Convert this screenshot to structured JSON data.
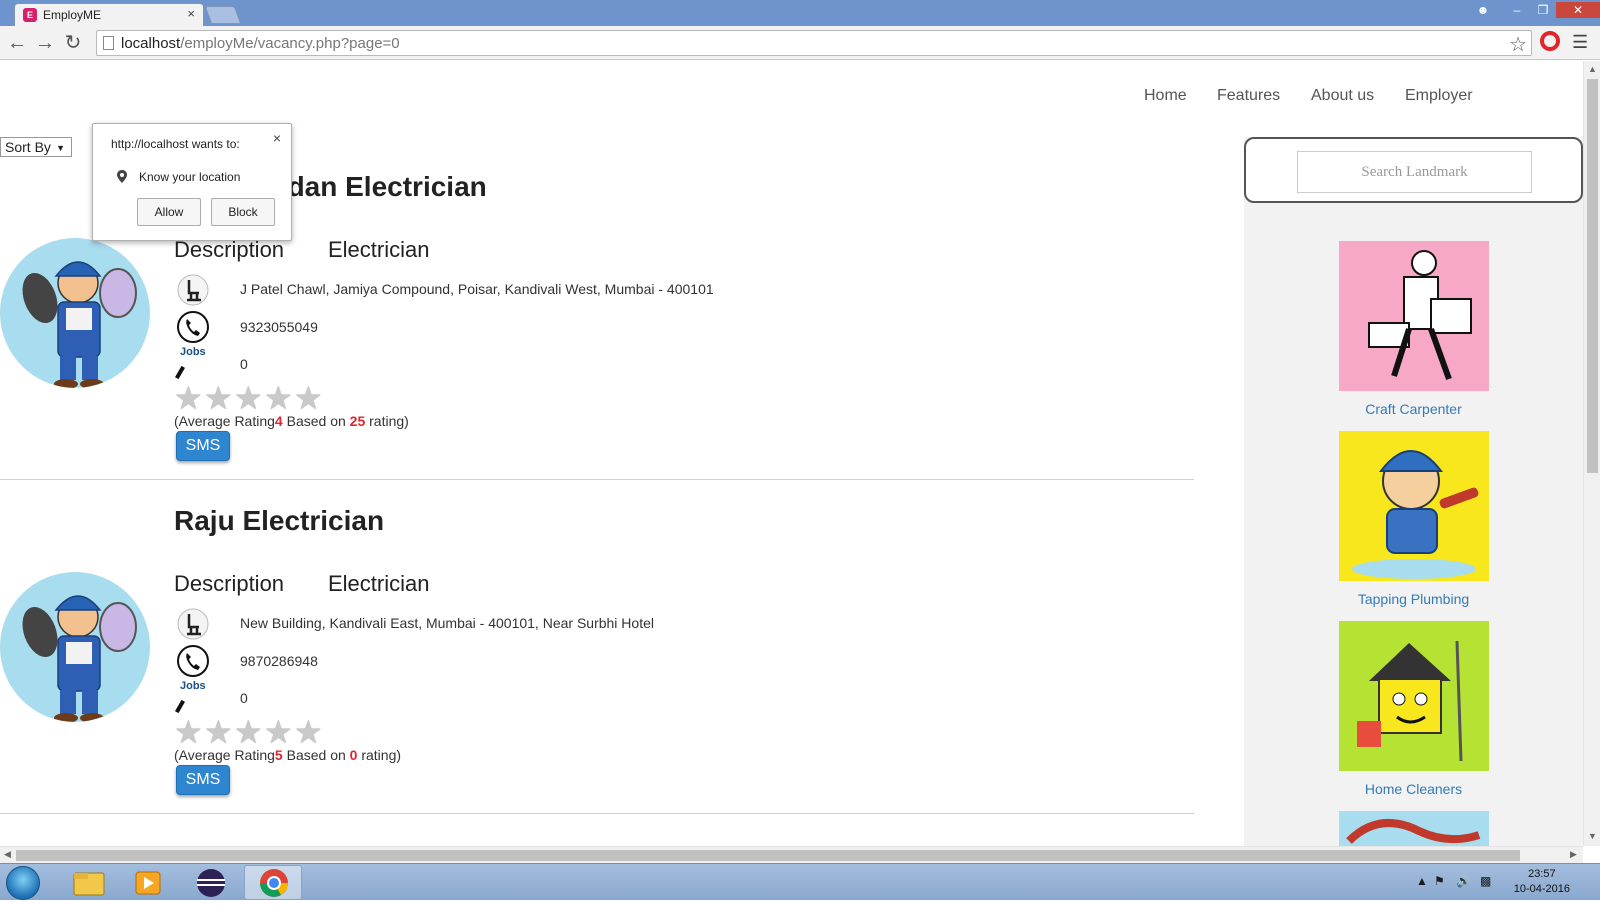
{
  "browser": {
    "tab_title": "EmployME",
    "tab_favicon": "E",
    "url_host": "localhost",
    "url_path": "/employMe/vacancy.php?page=0"
  },
  "permission_popup": {
    "title": "http://localhost wants to:",
    "request": "Know your location",
    "allow_label": "Allow",
    "block_label": "Block",
    "close_label": "×"
  },
  "nav": {
    "items": [
      "Home",
      "Features",
      "About us",
      "Employer"
    ]
  },
  "sort": {
    "label": "Sort By"
  },
  "listings": [
    {
      "title": "A1 Chandan Electrician",
      "desc_label": "Description",
      "desc_value": "Electrician",
      "address": "J Patel Chawl, Jamiya Compound, Poisar, Kandivali West, Mumbai - 400101",
      "phone": "9323055049",
      "jobs": "0",
      "rating_prefix": "(Average Rating",
      "rating_avg": "4",
      "rating_mid": " Based on ",
      "rating_count": "25",
      "rating_suffix": " rating)",
      "sms_label": "SMS"
    },
    {
      "title": "Raju Electrician",
      "desc_label": "Description",
      "desc_value": "Electrician",
      "address": "New Building, Kandivali East, Mumbai - 400101, Near Surbhi Hotel",
      "phone": "9870286948",
      "jobs": "0",
      "rating_prefix": "(Average Rating",
      "rating_avg": "5",
      "rating_mid": " Based on ",
      "rating_count": "0",
      "rating_suffix": " rating)",
      "sms_label": "SMS"
    }
  ],
  "icons": {
    "jobs_label": "Jobs"
  },
  "sidebar": {
    "search_placeholder": "Search Landmark",
    "categories": [
      {
        "label": "Craft Carpenter",
        "color": "#f7a8c7"
      },
      {
        "label": "Tapping Plumbing",
        "color": "#f8e71c"
      },
      {
        "label": "Home Cleaners",
        "color": "#b6e234"
      }
    ]
  },
  "taskbar": {
    "time": "23:57",
    "date": "10-04-2016"
  },
  "colors": {
    "accent_red": "#e0262c",
    "link_blue": "#337ab7",
    "sms_blue": "#2f86d0"
  }
}
